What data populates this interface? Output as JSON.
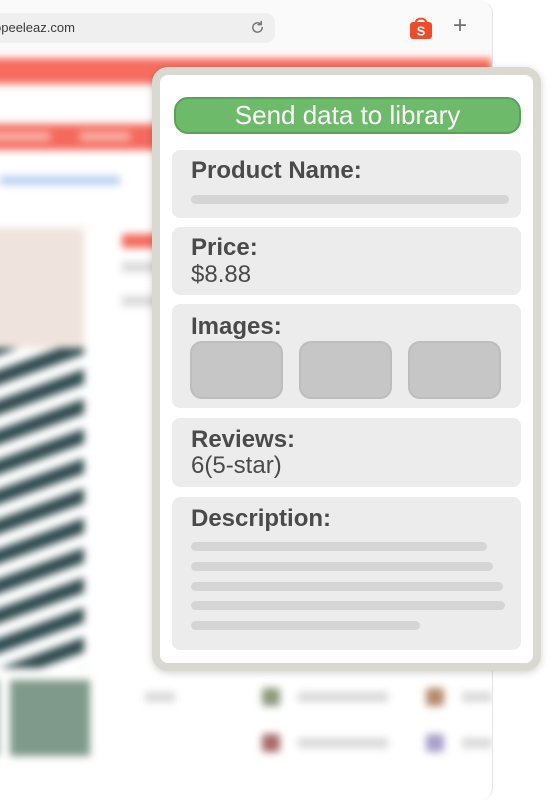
{
  "browser": {
    "url": "opeeleaz.com",
    "icons": {
      "reload": "reload-icon",
      "extension": "shopping-bag-icon",
      "new_tab": "plus-icon"
    },
    "new_tab_glyph": "+",
    "extension_glyph": "S"
  },
  "panel": {
    "send_button_label": "Send data to library",
    "product_name": {
      "label": "Product Name:"
    },
    "price": {
      "label": "Price:",
      "value": "$8.88"
    },
    "images": {
      "label": "Images:"
    },
    "reviews": {
      "label": "Reviews:",
      "value": "6(5-star)"
    },
    "description": {
      "label": "Description:"
    }
  },
  "colors": {
    "accent_green": "#6cba6a",
    "brand_orange": "#ee4d2d",
    "panel_border": "#d9d9d1",
    "card_bg": "#ececec"
  }
}
